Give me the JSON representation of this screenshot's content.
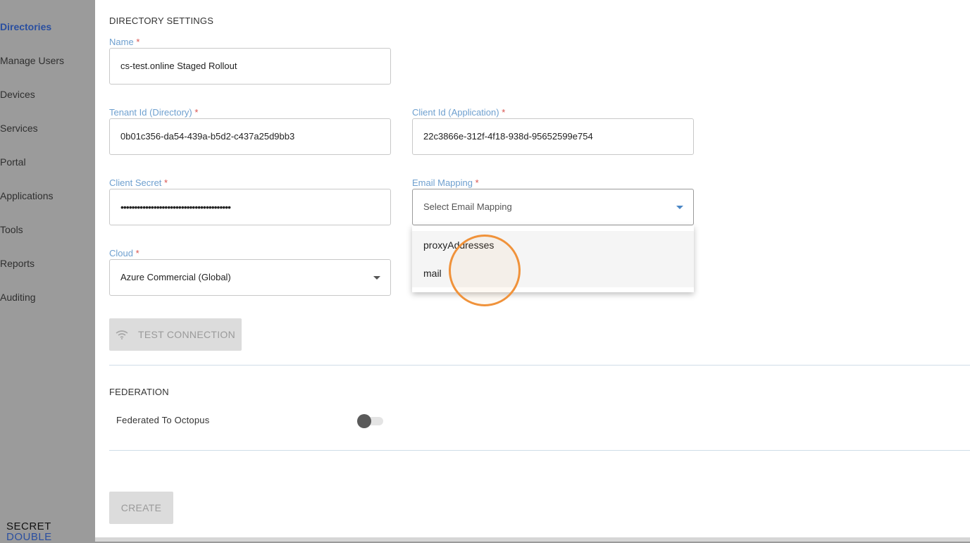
{
  "sidebar": {
    "items": [
      {
        "label": "Directories",
        "active": true
      },
      {
        "label": "Manage Users"
      },
      {
        "label": "Devices"
      },
      {
        "label": "Services"
      },
      {
        "label": "Portal"
      },
      {
        "label": "Applications"
      },
      {
        "label": "Tools"
      },
      {
        "label": "Reports"
      },
      {
        "label": "Auditing"
      }
    ],
    "logo": {
      "line1": "SECRET",
      "line2": "DOUBLE"
    }
  },
  "directory_settings": {
    "title": "DIRECTORY SETTINGS",
    "required_marker": "*",
    "name": {
      "label": "Name",
      "value": "cs-test.online Staged Rollout"
    },
    "tenant_id": {
      "label": "Tenant Id (Directory)",
      "value": "0b01c356-da54-439a-b5d2-c437a25d9bb3"
    },
    "client_id": {
      "label": "Client Id (Application)",
      "value": "22c3866e-312f-4f18-938d-95652599e754"
    },
    "client_secret": {
      "label": "Client Secret",
      "value": "••••••••••••••••••••••••••••••••••••••••"
    },
    "email_mapping": {
      "label": "Email Mapping",
      "placeholder": "Select Email Mapping",
      "options": [
        "proxyAddresses",
        "mail"
      ]
    },
    "cloud": {
      "label": "Cloud",
      "value": "Azure Commercial (Global)"
    },
    "test_connection_label": "TEST CONNECTION"
  },
  "federation": {
    "title": "FEDERATION",
    "federated_label": "Federated To Octopus",
    "federated_enabled": false
  },
  "create_label": "CREATE",
  "colors": {
    "accent": "#2a4fa0",
    "label": "#6fa0cf",
    "required": "#d9534f",
    "highlight_ring": "#f0923a"
  }
}
